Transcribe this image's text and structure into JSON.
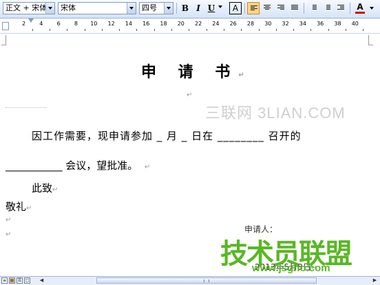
{
  "toolbar": {
    "style_value": "正文 + 宋体",
    "font_value": "宋体",
    "size_value": "四号",
    "bold_label": "B",
    "italic_label": "I",
    "underline_label": "U",
    "char_border_label": "A",
    "font_color_label": "A",
    "font_color": "#d00000",
    "accent": "#ffd58a"
  },
  "ruler": {
    "numbers": [
      "2",
      "4",
      "6",
      "8",
      "10",
      "12",
      "14",
      "16",
      "18",
      "20",
      "22",
      "24",
      "26",
      "28",
      "30",
      "32",
      "34",
      "36",
      "38",
      "40"
    ]
  },
  "document": {
    "paragraph_mark": "↵",
    "title": "申 请 书",
    "line1": "因工作需要，现申请参加 _ 月 _ 日在 ________ 召开的",
    "line2": "___________ 会议，望批准。",
    "line3": "此致",
    "line4": "敬礼",
    "signature": "申请人：",
    "date": "2013年5月8日"
  },
  "watermarks": {
    "site_text": "三联网 3LIAN.COM",
    "brand_text": "技术员联盟",
    "brand_url": "www.jsgho.com",
    "brand_color": "#59b824"
  }
}
